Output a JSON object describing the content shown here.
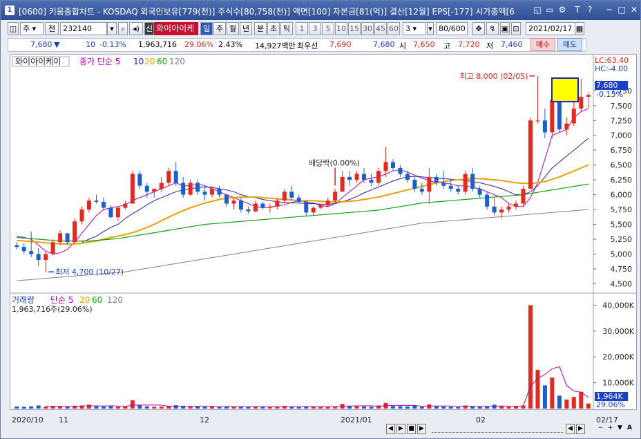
{
  "window": {
    "app_icon": "1",
    "title": "[0600] 키움종합차트 - KOSDAQ 외국인보유[779(천)] 주식수[80,758(천)] 액면[100] 자본금[81(억)] 결산[12월] EPS[-177] 시가총액[6",
    "controls": [
      "◱",
      "▭",
      "⚙",
      "T",
      "?",
      "─",
      "□",
      "✕"
    ]
  },
  "toolbar": {
    "period_select": "주",
    "prev_label": "전",
    "code": "232140",
    "shin_label": "신",
    "stock_name": "와이아이케",
    "period_buttons": [
      "일",
      "주",
      "월",
      "년",
      "분",
      "초",
      "틱"
    ],
    "tick_buttons": [
      "1",
      "3",
      "5",
      "10",
      "15",
      "30",
      "45",
      "60"
    ],
    "interval": "3",
    "count": "80/600",
    "date": "2021/02/17"
  },
  "quote": {
    "price": "7,680",
    "change_arrow": "▼",
    "change": "10",
    "change_pct": "-0.13%",
    "volume": "1,963,716",
    "volume_pct": "29.06%",
    "turnover_pct": "2.43%",
    "amount": "14,927백만",
    "best_label": "최우선",
    "best_ask": "7,690",
    "best_bid": "7,680",
    "open_label": "시",
    "open": "7,650",
    "high_label": "고",
    "high": "7,720",
    "low_label": "저",
    "low": "7,460",
    "buy_label": "매수",
    "sell_label": "매도"
  },
  "chart_data": [
    {
      "type": "candlestick",
      "title": "와이아이케이",
      "legend_label": "종가 단순",
      "ma_periods": [
        "5",
        "10",
        "20",
        "60",
        "120"
      ],
      "ma_colors": [
        "#b000b0",
        "#2020a0",
        "#e8a000",
        "#10a010",
        "#808080"
      ],
      "up_color": "#e8281e",
      "down_color": "#1a5fd0",
      "y_ticks": [
        "7,750",
        "7,500",
        "7,250",
        "7,000",
        "6,750",
        "6,500",
        "6,250",
        "6,000",
        "5,750",
        "5,500",
        "5,250",
        "5,000",
        "4,750",
        "4,500"
      ],
      "ylim": [
        4400,
        8150
      ],
      "lc_label": "LC:63.40",
      "hc_label": "HC:-4.00",
      "last_price": "7,680",
      "last_change_pct": "-0.13%",
      "annotation_high": "최고 8,000 (02/05)",
      "annotation_low": "최저 4,700 (10/27)",
      "annotation_dividend": "배당락(0.00%)",
      "candles": [
        [
          5150,
          5200,
          5080,
          5120
        ],
        [
          5120,
          5180,
          5000,
          5050
        ],
        [
          5050,
          5380,
          4950,
          5000
        ],
        [
          5000,
          5100,
          4800,
          4900
        ],
        [
          4900,
          5050,
          4700,
          5000
        ],
        [
          5000,
          5250,
          4980,
          5200
        ],
        [
          5200,
          5400,
          5150,
          5350
        ],
        [
          5350,
          5350,
          5150,
          5200
        ],
        [
          5200,
          5600,
          5200,
          5550
        ],
        [
          5550,
          5800,
          5500,
          5750
        ],
        [
          5750,
          5950,
          5700,
          5900
        ],
        [
          5900,
          6000,
          5850,
          5880
        ],
        [
          5880,
          5950,
          5750,
          5780
        ],
        [
          5780,
          5820,
          5600,
          5620
        ],
        [
          5620,
          5800,
          5550,
          5780
        ],
        [
          5780,
          5900,
          5750,
          5850
        ],
        [
          5850,
          6400,
          5850,
          6350
        ],
        [
          6350,
          6400,
          6100,
          6150
        ],
        [
          6150,
          6200,
          5950,
          6050
        ],
        [
          6050,
          6100,
          5950,
          6100
        ],
        [
          6100,
          6300,
          6050,
          6200
        ],
        [
          6200,
          6450,
          6150,
          6400
        ],
        [
          6400,
          6550,
          6150,
          6200
        ],
        [
          6200,
          6300,
          5950,
          6000
        ],
        [
          6000,
          6250,
          5980,
          6200
        ],
        [
          6200,
          6250,
          6000,
          6050
        ],
        [
          6050,
          6150,
          5900,
          6000
        ],
        [
          6000,
          6150,
          5950,
          6100
        ],
        [
          6100,
          6150,
          5950,
          6000
        ],
        [
          6000,
          6000,
          5800,
          5850
        ],
        [
          5850,
          5950,
          5750,
          5900
        ],
        [
          5900,
          5950,
          5700,
          5750
        ],
        [
          5750,
          5800,
          5680,
          5720
        ],
        [
          5720,
          5900,
          5700,
          5850
        ],
        [
          5850,
          5880,
          5750,
          5780
        ],
        [
          5780,
          5850,
          5700,
          5800
        ],
        [
          5800,
          5950,
          5750,
          5900
        ],
        [
          5900,
          6100,
          5850,
          6050
        ],
        [
          6050,
          6150,
          5900,
          5950
        ],
        [
          5950,
          6000,
          5850,
          5880
        ],
        [
          5880,
          5900,
          5650,
          5700
        ],
        [
          5700,
          5800,
          5650,
          5780
        ],
        [
          5780,
          5850,
          5750,
          5820
        ],
        [
          5820,
          5950,
          5800,
          5900
        ],
        [
          5900,
          6100,
          5850,
          6050
        ],
        [
          6050,
          6400,
          6050,
          6300
        ],
        [
          6300,
          6400,
          6150,
          6250
        ],
        [
          6250,
          6400,
          6200,
          6350
        ],
        [
          6350,
          6450,
          6200,
          6250
        ],
        [
          6250,
          6350,
          6150,
          6200
        ],
        [
          6200,
          6450,
          6150,
          6400
        ],
        [
          6400,
          6800,
          6300,
          6550
        ],
        [
          6550,
          6600,
          6400,
          6450
        ],
        [
          6450,
          6500,
          6300,
          6350
        ],
        [
          6350,
          6400,
          6200,
          6250
        ],
        [
          6250,
          6300,
          6050,
          6100
        ],
        [
          6100,
          6200,
          6000,
          6050
        ],
        [
          6050,
          6450,
          5850,
          6300
        ],
        [
          6300,
          6350,
          6150,
          6200
        ],
        [
          6200,
          6400,
          6100,
          6150
        ],
        [
          6150,
          6250,
          6050,
          6100
        ],
        [
          6100,
          6150,
          6000,
          6050
        ],
        [
          6050,
          6400,
          6000,
          6350
        ],
        [
          6350,
          6450,
          6050,
          6100
        ],
        [
          6100,
          6150,
          5950,
          6000
        ],
        [
          6000,
          6050,
          5750,
          5800
        ],
        [
          5800,
          5950,
          5650,
          5700
        ],
        [
          5700,
          5800,
          5600,
          5750
        ],
        [
          5750,
          5850,
          5700,
          5800
        ],
        [
          5800,
          5900,
          5750,
          5850
        ],
        [
          5850,
          6150,
          5800,
          6100
        ],
        [
          6100,
          7300,
          6100,
          7250
        ],
        [
          7250,
          8000,
          7200,
          7250
        ],
        [
          7250,
          7450,
          6950,
          7050
        ],
        [
          7050,
          7900,
          6950,
          7600
        ],
        [
          7600,
          7700,
          7050,
          7100
        ],
        [
          7100,
          7300,
          7000,
          7200
        ],
        [
          7200,
          7600,
          7150,
          7450
        ],
        [
          7450,
          7950,
          7400,
          7650
        ],
        [
          7650,
          7720,
          7460,
          7680
        ]
      ],
      "ma5": [
        5300,
        5280,
        5250,
        5150,
        5050,
        5000,
        5020,
        5080,
        5200,
        5350,
        5500,
        5650,
        5750,
        5780,
        5800,
        5830,
        5900,
        5950,
        6000,
        6050,
        6100,
        6150,
        6200,
        6150,
        6150,
        6180,
        6150,
        6100,
        6050,
        6000,
        5950,
        5900,
        5850,
        5800,
        5780,
        5790,
        5810,
        5830,
        5870,
        5900,
        5880,
        5860,
        5820,
        5800,
        5850,
        5950,
        6050,
        6150,
        6250,
        6280,
        6300,
        6350,
        6400,
        6420,
        6380,
        6330,
        6280,
        6240,
        6200,
        6200,
        6180,
        6150,
        6150,
        6120,
        6100,
        6050,
        6000,
        5950,
        5850,
        5800,
        5800,
        5950,
        6200,
        6600,
        7000,
        7050,
        7100,
        7300,
        7400,
        7450
      ],
      "ma10": [
        null,
        null,
        null,
        null,
        null,
        null,
        null,
        null,
        null,
        5200,
        5250,
        5300,
        5380,
        5450,
        5500,
        5600,
        5680,
        5750,
        5830,
        5900,
        5950,
        6000,
        6050,
        6080,
        6100,
        6120,
        6130,
        6120,
        6100,
        6080,
        6050,
        6000,
        5970,
        5950,
        5920,
        5900,
        5880,
        5870,
        5860,
        5860,
        5850,
        5850,
        5840,
        5840,
        5850,
        5880,
        5920,
        5970,
        6030,
        6080,
        6130,
        6180,
        6230,
        6270,
        6300,
        6310,
        6300,
        6290,
        6280,
        6270,
        6260,
        6250,
        6240,
        6220,
        6200,
        6170,
        6140,
        6100,
        6050,
        6000,
        6000,
        6050,
        6150,
        6300,
        6450,
        6550,
        6650,
        6750,
        6850,
        6950
      ],
      "ma20": [
        5230,
        5220,
        5210,
        5200,
        5190,
        5180,
        5170,
        5170,
        5170,
        5180,
        5200,
        5220,
        5250,
        5280,
        5300,
        5330,
        5360,
        5400,
        5450,
        5500,
        5560,
        5620,
        5680,
        5730,
        5780,
        5820,
        5860,
        5890,
        5920,
        5940,
        5950,
        5960,
        5960,
        5960,
        5950,
        5940,
        5930,
        5920,
        5910,
        5900,
        5900,
        5900,
        5890,
        5880,
        5880,
        5880,
        5890,
        5900,
        5920,
        5940,
        5960,
        5990,
        6020,
        6050,
        6080,
        6110,
        6140,
        6170,
        6200,
        6220,
        6240,
        6250,
        6260,
        6270,
        6270,
        6260,
        6250,
        6240,
        6220,
        6200,
        6190,
        6190,
        6200,
        6220,
        6260,
        6300,
        6350,
        6400,
        6450,
        6500
      ],
      "ma60": [
        5280,
        5270,
        5260,
        5250,
        5240,
        5230,
        5220,
        5220,
        5220,
        5220,
        5220,
        5230,
        5240,
        5250,
        5260,
        5280,
        5300,
        5320,
        5340,
        5360,
        5380,
        5400,
        5420,
        5440,
        5460,
        5480,
        5500,
        5510,
        5520,
        5530,
        5540,
        5550,
        5560,
        5570,
        5580,
        5590,
        5600,
        5610,
        5620,
        5630,
        5640,
        5650,
        5660,
        5670,
        5680,
        5690,
        5700,
        5710,
        5720,
        5730,
        5740,
        5760,
        5780,
        5800,
        5820,
        5840,
        5860,
        5870,
        5880,
        5890,
        5900,
        5910,
        5920,
        5930,
        5940,
        5950,
        5960,
        5970,
        5980,
        5990,
        6000,
        6020,
        6040,
        6060,
        6080,
        6100,
        6120,
        6140,
        6160,
        6180
      ],
      "ma120": [
        4550,
        4560,
        4570,
        4580,
        4590,
        4600,
        4610,
        4620,
        4630,
        4640,
        4650,
        4660,
        4670,
        4680,
        4690,
        4700,
        4720,
        4740,
        4760,
        4780,
        4800,
        4820,
        4840,
        4860,
        4880,
        4900,
        4920,
        4940,
        4960,
        4980,
        5000,
        5020,
        5040,
        5060,
        5080,
        5100,
        5120,
        5140,
        5160,
        5180,
        5200,
        5220,
        5240,
        5260,
        5280,
        5300,
        5320,
        5340,
        5360,
        5380,
        5400,
        5420,
        5440,
        5460,
        5480,
        5500,
        5520,
        5530,
        5540,
        5550,
        5560,
        5570,
        5580,
        5590,
        5600,
        5610,
        5620,
        5630,
        5640,
        5650,
        5660,
        5670,
        5680,
        5690,
        5700,
        5710,
        5720,
        5730,
        5740,
        5750
      ]
    },
    {
      "type": "bar",
      "title": "거래량",
      "legend_label": "단순",
      "ma_periods": [
        "5",
        "20",
        "60",
        "120"
      ],
      "ma_colors": [
        "#b000b0",
        "#e8a000",
        "#10a010",
        "#808080"
      ],
      "volume_text": "1,963,716주(29.06%)",
      "y_ticks": [
        "40,000K",
        "30,000K",
        "20,000K",
        "10,000K"
      ],
      "ylim": [
        0,
        42000
      ],
      "last_value": "1,964K",
      "last_pct": "29.06%",
      "values": [
        800,
        700,
        900,
        1200,
        700,
        900,
        800,
        700,
        1100,
        1200,
        1500,
        900,
        800,
        900,
        700,
        800,
        3200,
        1200,
        900,
        700,
        800,
        1000,
        1300,
        900,
        700,
        800,
        700,
        800,
        600,
        900,
        800,
        700,
        600,
        800,
        700,
        600,
        800,
        1000,
        700,
        600,
        900,
        700,
        600,
        700,
        800,
        1800,
        1000,
        900,
        800,
        700,
        1200,
        2200,
        1000,
        900,
        800,
        1100,
        700,
        1600,
        900,
        800,
        700,
        600,
        1200,
        800,
        700,
        900,
        1500,
        800,
        700,
        800,
        1200,
        40000,
        15000,
        9000,
        12000,
        5000,
        3500,
        4500,
        6500,
        1964
      ],
      "ma5_values": [
        null,
        null,
        null,
        null,
        900,
        900,
        860,
        840,
        880,
        980,
        1060,
        1040,
        1000,
        1060,
        960,
        820,
        1300,
        1360,
        1360,
        1360,
        1360,
        920,
        940,
        940,
        900,
        900,
        900,
        860,
        720,
        760,
        760,
        760,
        720,
        760,
        720,
        680,
        700,
        740,
        740,
        720,
        740,
        740,
        720,
        700,
        740,
        900,
        1000,
        1040,
        1100,
        1080,
        920,
        1160,
        1220,
        1220,
        1220,
        1200,
        920,
        1020,
        1020,
        1020,
        980,
        920,
        960,
        860,
        820,
        840,
        940,
        1000,
        940,
        940,
        1000,
        8700,
        11600,
        13220,
        15400,
        16200,
        8900,
        6800,
        6300,
        4300
      ]
    }
  ],
  "xaxis": {
    "labels": [
      "2020/10",
      "11",
      "12",
      "2021/01",
      "02",
      "02/17"
    ]
  }
}
